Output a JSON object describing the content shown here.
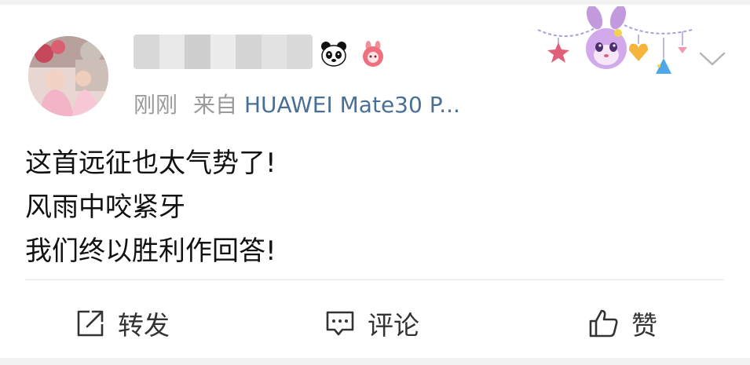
{
  "post": {
    "author": {
      "name_blurred": true,
      "badges": [
        "panda-icon",
        "pink-rabbit-icon"
      ]
    },
    "time": "刚刚",
    "source_prefix": "来自",
    "source_device": "HUAWEI Mate30 P...",
    "content_lines": [
      "这首远征也太气势了!",
      "风雨中咬紧牙",
      "我们终以胜利作回答!"
    ]
  },
  "actions": {
    "repost_label": "转发",
    "comment_label": "评论",
    "like_label": "赞"
  },
  "colors": {
    "source_link": "#4a6f94",
    "meta_gray": "#9a9a9a",
    "text": "#111111",
    "background": "#f2f2f2"
  }
}
